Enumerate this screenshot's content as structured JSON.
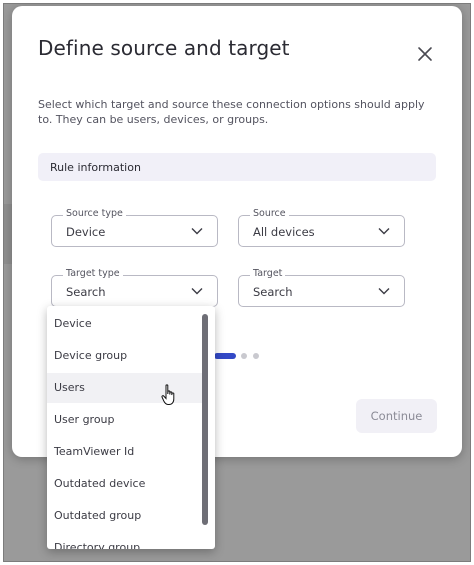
{
  "dialog": {
    "title": "Define source and target",
    "description": "Select which target and source these connection options should apply to. They can be users, devices, or groups.",
    "section_label": "Rule information"
  },
  "fields": {
    "source_type": {
      "label": "Source type",
      "value": "Device"
    },
    "source": {
      "label": "Source",
      "value": "All devices"
    },
    "target_type": {
      "label": "Target type",
      "value": "Search"
    },
    "target": {
      "label": "Target",
      "value": "Search"
    }
  },
  "dropdown": {
    "options": [
      "Device",
      "Device group",
      "Users",
      "User group",
      "TeamViewer Id",
      "Outdated device",
      "Outdated group",
      "Directory group"
    ],
    "hovered_option": "Users"
  },
  "stepper": {
    "steps": 3,
    "active_step": 1
  },
  "actions": {
    "continue_label": "Continue"
  },
  "colors": {
    "accent": "#3349c6",
    "section_bg": "#f1f0f8",
    "overlay": "#9a9a9a",
    "disabled_button_bg": "#f1f0f6",
    "disabled_button_text": "#8b8b96"
  },
  "icons": {
    "close": "close-icon",
    "dropdown_chevron": "chevron-down-icon",
    "pointer": "hand-cursor-icon"
  }
}
